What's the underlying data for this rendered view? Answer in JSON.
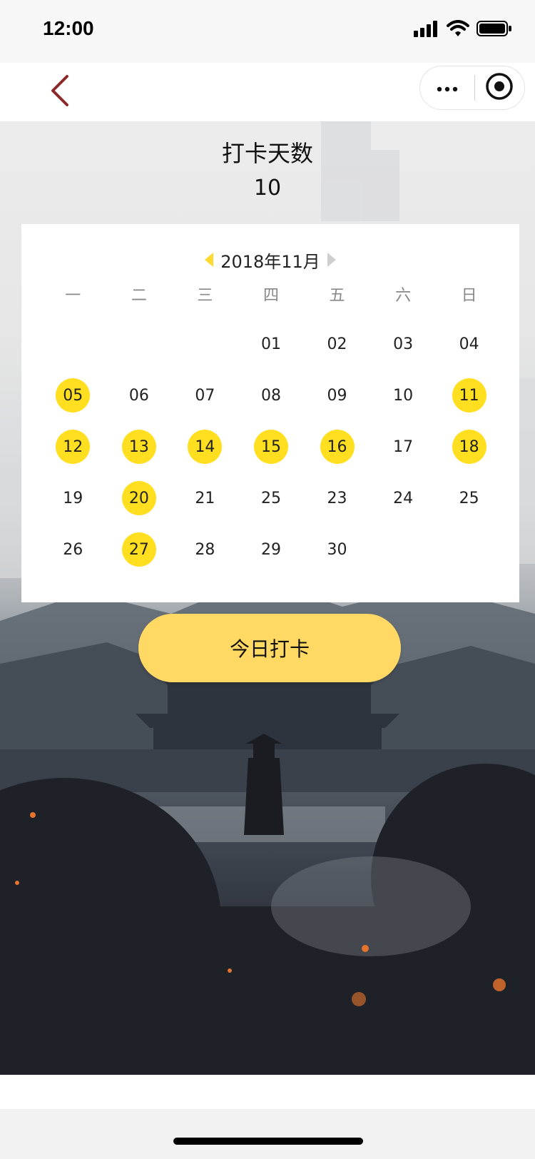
{
  "status_bar": {
    "time": "12:00"
  },
  "nav": {
    "back_icon": "chevron-left-icon",
    "more_icon": "more-dots-icon",
    "close_icon": "target-circle-icon",
    "accent_color": "#8b2a2a"
  },
  "summary": {
    "title": "打卡天数",
    "count": "10"
  },
  "calendar": {
    "month_label": "2018年11月",
    "weekdays": [
      "一",
      "二",
      "三",
      "四",
      "五",
      "六",
      "日"
    ],
    "leading_blanks": 3,
    "days": [
      "01",
      "02",
      "03",
      "04",
      "05",
      "06",
      "07",
      "08",
      "09",
      "10",
      "11",
      "12",
      "13",
      "14",
      "15",
      "16",
      "17",
      "18",
      "19",
      "20",
      "21",
      "25",
      "23",
      "24",
      "25",
      "26",
      "27",
      "28",
      "29",
      "30"
    ],
    "checked_days": [
      "05",
      "11",
      "12",
      "13",
      "14",
      "15",
      "16",
      "18",
      "20",
      "27"
    ],
    "checked_color": "#ffdf1f"
  },
  "actions": {
    "checkin_label": "今日打卡",
    "checkin_color": "#ffd963"
  }
}
